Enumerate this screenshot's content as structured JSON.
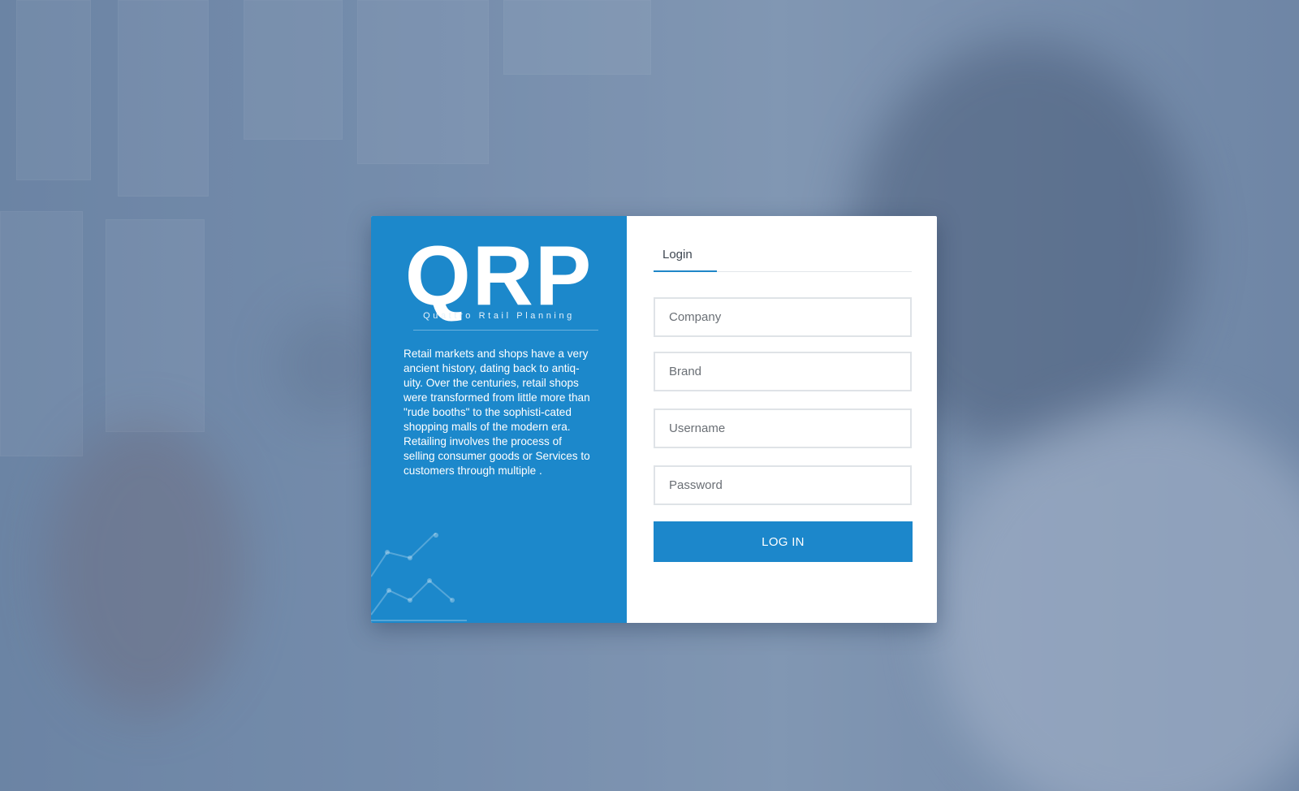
{
  "brand": {
    "logo_text": "QRP",
    "tagline": "Quattro Rtail Planning",
    "description": "Retail markets and shops have a very ancient history, dating back to antiq-uity. Over the centuries, retail shops were transformed from little more than \"rude booths\" to the sophisti-cated shopping malls of the modern era. Retailing involves the process of selling consumer goods or Services to customers through multiple ."
  },
  "login": {
    "tab_label": "Login",
    "fields": {
      "company_placeholder": "Company",
      "brand_placeholder": "Brand",
      "username_placeholder": "Username",
      "password_placeholder": "Password"
    },
    "submit_label": "LOG IN"
  },
  "colors": {
    "accent": "#1c88cb",
    "tab_underline": "#1f86c8",
    "input_border": "#dfe3e7",
    "background_overlay": "#2c5082"
  },
  "icons": {
    "decoration": "line-chart-icon"
  }
}
